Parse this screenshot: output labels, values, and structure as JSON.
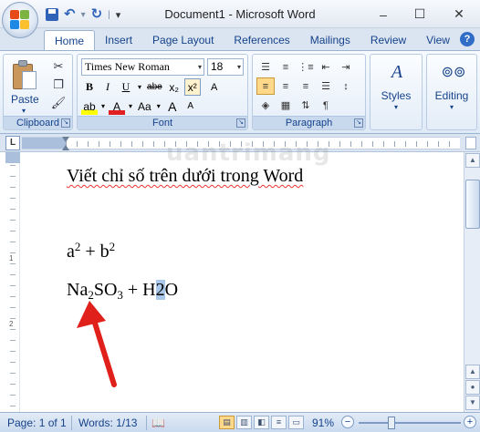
{
  "window": {
    "title": "Document1 - Microsoft Word",
    "minimize": "–",
    "maximize": "☐",
    "close": "✕"
  },
  "qat": {
    "save": "save-icon",
    "undo": "↶",
    "redo": "↻",
    "more": "▾"
  },
  "tabs": [
    "Home",
    "Insert",
    "Page Layout",
    "References",
    "Mailings",
    "Review",
    "View"
  ],
  "help": "?",
  "ribbon": {
    "clipboard": {
      "label": "Clipboard",
      "paste": "Paste",
      "paste_arrow": "▾"
    },
    "font": {
      "label": "Font",
      "name": "Times New Roman",
      "size": "18",
      "grow": "A",
      "shrink": "A",
      "clear": "A",
      "bold": "B",
      "italic": "I",
      "underline": "U",
      "strike": "abe",
      "subscript": "x₂",
      "superscript": "x²",
      "change_case": "Aa",
      "font_color": "A"
    },
    "paragraph": {
      "label": "Paragraph",
      "pilcrow": "¶"
    },
    "styles": {
      "label": "Styles",
      "icon": "A"
    },
    "editing": {
      "label": "Editing"
    }
  },
  "ruler": {
    "tab_selector": "L"
  },
  "watermark": "uantrimang",
  "document": {
    "line1": "Viết chỉ số trên dưới trong Word",
    "line2": {
      "a": "a",
      "sup1": "2",
      "plus": " + b",
      "sup2": "2"
    },
    "line3": {
      "na": "Na",
      "sub2": "2",
      "so": "SO",
      "sub3": "3",
      "rest": " + H",
      "hl": "2",
      "o": "O"
    }
  },
  "status": {
    "page": "Page: 1 of 1",
    "words": "Words: 1/13",
    "zoom": "91%",
    "minus": "−",
    "plus": "+"
  },
  "colors": {
    "accent": "#15428b",
    "arrow": "#e0201a",
    "selection": "#a9c8ea"
  }
}
